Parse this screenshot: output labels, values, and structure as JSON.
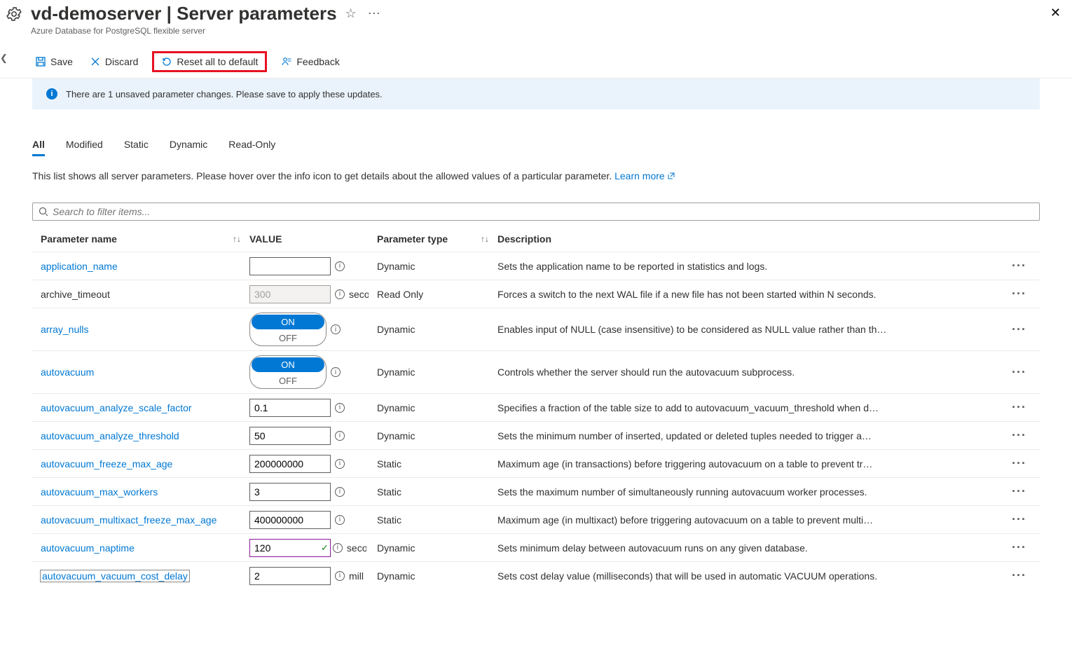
{
  "header": {
    "server_name": "vd-demoserver",
    "page_title": "Server parameters",
    "subtitle": "Azure Database for PostgreSQL flexible server"
  },
  "toolbar": {
    "save": "Save",
    "discard": "Discard",
    "reset": "Reset all to default",
    "feedback": "Feedback"
  },
  "banner": {
    "message": "There are 1 unsaved parameter changes.  Please save to apply these updates."
  },
  "tabs": {
    "all": "All",
    "modified": "Modified",
    "static": "Static",
    "dynamic": "Dynamic",
    "readonly": "Read-Only"
  },
  "intro": {
    "text": "This list shows all server parameters. Please hover over the info icon to get details about the allowed values of a particular parameter. ",
    "link": "Learn more"
  },
  "search": {
    "placeholder": "Search to filter items..."
  },
  "columns": {
    "name": "Parameter name",
    "value": "VALUE",
    "type": "Parameter type",
    "desc": "Description"
  },
  "rows": [
    {
      "name": "application_name",
      "link": true,
      "vtype": "text",
      "value": "",
      "unit": "",
      "type": "Dynamic",
      "desc": "Sets the application name to be reported in statistics and logs."
    },
    {
      "name": "archive_timeout",
      "link": false,
      "vtype": "text",
      "value": "300",
      "ro": true,
      "unit": "seconds",
      "type": "Read Only",
      "desc": "Forces a switch to the next WAL file if a new file has not been started within N seconds."
    },
    {
      "name": "array_nulls",
      "link": true,
      "vtype": "toggle",
      "on": "ON",
      "off": "OFF",
      "type": "Dynamic",
      "desc": "Enables input of NULL (case insensitive) to be considered as NULL value rather than th…"
    },
    {
      "name": "autovacuum",
      "link": true,
      "vtype": "toggle",
      "on": "ON",
      "off": "OFF",
      "type": "Dynamic",
      "desc": "Controls whether the server should run the autovacuum subprocess."
    },
    {
      "name": "autovacuum_analyze_scale_factor",
      "link": true,
      "vtype": "text",
      "value": "0.1",
      "unit": "",
      "type": "Dynamic",
      "desc": "Specifies a fraction of the table size to add to autovacuum_vacuum_threshold when d…"
    },
    {
      "name": "autovacuum_analyze_threshold",
      "link": true,
      "vtype": "text",
      "value": "50",
      "unit": "",
      "type": "Dynamic",
      "desc": "Sets the minimum number of inserted, updated or deleted tuples needed to trigger a…"
    },
    {
      "name": "autovacuum_freeze_max_age",
      "link": true,
      "vtype": "text",
      "value": "200000000",
      "unit": "",
      "type": "Static",
      "desc": "Maximum age (in transactions) before triggering autovacuum on a table to prevent tr…"
    },
    {
      "name": "autovacuum_max_workers",
      "link": true,
      "vtype": "text",
      "value": "3",
      "unit": "",
      "type": "Static",
      "desc": "Sets the maximum number of simultaneously running autovacuum worker processes."
    },
    {
      "name": "autovacuum_multixact_freeze_max_age",
      "link": true,
      "vtype": "text",
      "value": "400000000",
      "unit": "",
      "type": "Static",
      "desc": "Maximum age (in multixact) before triggering autovacuum on a table to prevent multi…"
    },
    {
      "name": "autovacuum_naptime",
      "link": true,
      "vtype": "text",
      "value": "120",
      "changed": true,
      "unit": "seconds",
      "type": "Dynamic",
      "desc": "Sets minimum delay between autovacuum runs on any given database."
    },
    {
      "name": "autovacuum_vacuum_cost_delay",
      "link": true,
      "boxed": true,
      "vtype": "text",
      "value": "2",
      "unit": "milliseconds",
      "type": "Dynamic",
      "desc": "Sets cost delay value (milliseconds) that will be used in automatic VACUUM operations."
    }
  ]
}
